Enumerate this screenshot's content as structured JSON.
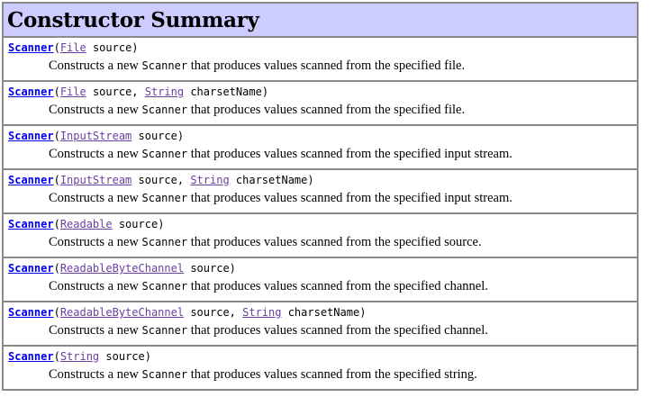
{
  "summary": {
    "title": "Constructor Summary"
  },
  "constructors": [
    {
      "name": "Scanner",
      "p1_type": "File",
      "p1_name": " source",
      "p2_type": "",
      "p2_name": "",
      "desc_pre": "Constructs a new ",
      "desc_code": "Scanner",
      "desc_post": " that produces values scanned from the specified file."
    },
    {
      "name": "Scanner",
      "p1_type": "File",
      "p1_name": " source, ",
      "p2_type": "String",
      "p2_name": " charsetName",
      "desc_pre": "Constructs a new ",
      "desc_code": "Scanner",
      "desc_post": " that produces values scanned from the specified file."
    },
    {
      "name": "Scanner",
      "p1_type": "InputStream",
      "p1_name": " source",
      "p2_type": "",
      "p2_name": "",
      "desc_pre": "Constructs a new ",
      "desc_code": "Scanner",
      "desc_post": " that produces values scanned from the specified input stream."
    },
    {
      "name": "Scanner",
      "p1_type": "InputStream",
      "p1_name": " source, ",
      "p2_type": "String",
      "p2_name": " charsetName",
      "desc_pre": "Constructs a new ",
      "desc_code": "Scanner",
      "desc_post": " that produces values scanned from the specified input stream."
    },
    {
      "name": "Scanner",
      "p1_type": "Readable",
      "p1_name": " source",
      "p2_type": "",
      "p2_name": "",
      "desc_pre": "Constructs a new ",
      "desc_code": "Scanner",
      "desc_post": " that produces values scanned from the specified source."
    },
    {
      "name": "Scanner",
      "p1_type": "ReadableByteChannel",
      "p1_name": " source",
      "p2_type": "",
      "p2_name": "",
      "desc_pre": "Constructs a new ",
      "desc_code": "Scanner",
      "desc_post": " that produces values scanned from the specified channel."
    },
    {
      "name": "Scanner",
      "p1_type": "ReadableByteChannel",
      "p1_name": " source, ",
      "p2_type": "String",
      "p2_name": " charsetName",
      "desc_pre": "Constructs a new ",
      "desc_code": "Scanner",
      "desc_post": " that produces values scanned from the specified channel."
    },
    {
      "name": "Scanner",
      "p1_type": "String",
      "p1_name": " source",
      "p2_type": "",
      "p2_name": "",
      "desc_pre": "Constructs a new ",
      "desc_code": "Scanner",
      "desc_post": " that produces values scanned from the specified string."
    }
  ]
}
